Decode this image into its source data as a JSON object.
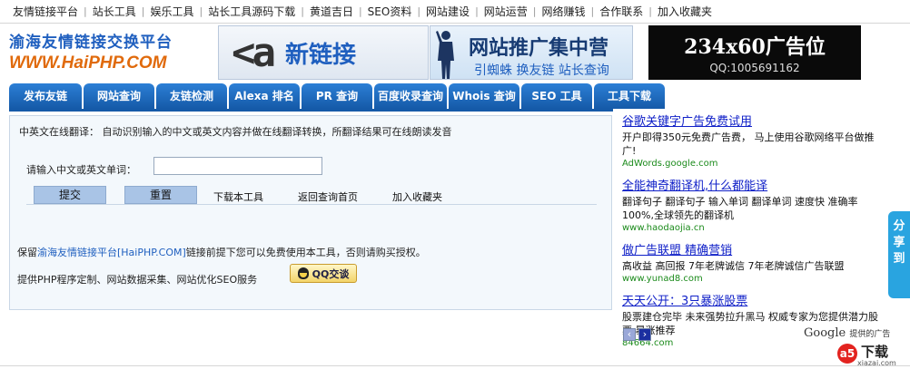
{
  "topnav": {
    "items": [
      "友情链接平台",
      "站长工具",
      "娱乐工具",
      "站长工具源码下载",
      "黄道吉日",
      "SEO资料",
      "网站建设",
      "网站运营",
      "网络赚钱",
      "合作联系",
      "加入收藏夹"
    ],
    "separator": "|"
  },
  "logo": {
    "line1": "渝海友情链接交换平台",
    "line2": "WWW.HaiPHP.COM"
  },
  "ads": {
    "ad1": {
      "mark": "<a",
      "text": "新链接"
    },
    "ad2": {
      "title": "网站推广集中营",
      "subtitle": "引蜘蛛 换友链 站长查询"
    },
    "ad3": {
      "title": "234x60广告位",
      "contact": "QQ:1005691162"
    }
  },
  "tabs": [
    "发布友链",
    "网站查询",
    "友链检测",
    "Alexa 排名",
    "PR 查询",
    "百度收录查询",
    "Whois 查询",
    "SEO 工具",
    "工具下载"
  ],
  "panel": {
    "intro": "中英文在线翻译：  自动识别输入的中文或英文内容并做在线翻译转换，所翻译结果可在线朗读发音",
    "input_label": "请输入中文或英文单词：",
    "input_value": "",
    "submit": "提交",
    "reset": "重置",
    "links": [
      "下载本工具",
      "返回查询首页",
      "加入收藏夹"
    ],
    "notice_prefix": "保留",
    "notice_link": "渝海友情链接平台[HaiPHP.COM]",
    "notice_suffix": "链接前提下您可以免费使用本工具，否则请购买授权。",
    "services": "提供PHP程序定制、网站数据采集、网站优化SEO服务",
    "qq_label": "QQ交谈"
  },
  "right_ads": [
    {
      "title": "谷歌关键字广告免费试用",
      "desc": "开户即得350元免费广告费， 马上使用谷歌网络平台做推广!",
      "url": "AdWords.google.com"
    },
    {
      "title": "全能神奇翻译机,什么都能译",
      "desc": "翻译句子 翻译句子 输入单词 翻译单词 速度快 准确率100%,全球领先的翻译机",
      "url": "www.haodaojia.cn"
    },
    {
      "title": "做广告联盟 精确营销",
      "desc": "高收益 高回报  7年老牌诚信  7年老牌诚信广告联盟",
      "url": "www.yunad8.com"
    },
    {
      "title": "天天公开：3只暴涨股票",
      "desc": "股票建仓完毕 未来强势拉升黑马 权威专家为您提供潜力股票 暴涨推荐",
      "url": "84664.com"
    }
  ],
  "pager": {
    "prev": "‹",
    "next": "›"
  },
  "google": {
    "brand": "Google",
    "label": "提供的广告"
  },
  "share": {
    "label": "分享到"
  },
  "watermark": {
    "mark": "a5",
    "big": "下载",
    "small": "xiazai.com"
  },
  "colors": {
    "tab_blue": "#1b63b7",
    "link_blue": "#1020c8",
    "url_green": "#1a8a1a",
    "share_blue": "#29a4e0"
  }
}
